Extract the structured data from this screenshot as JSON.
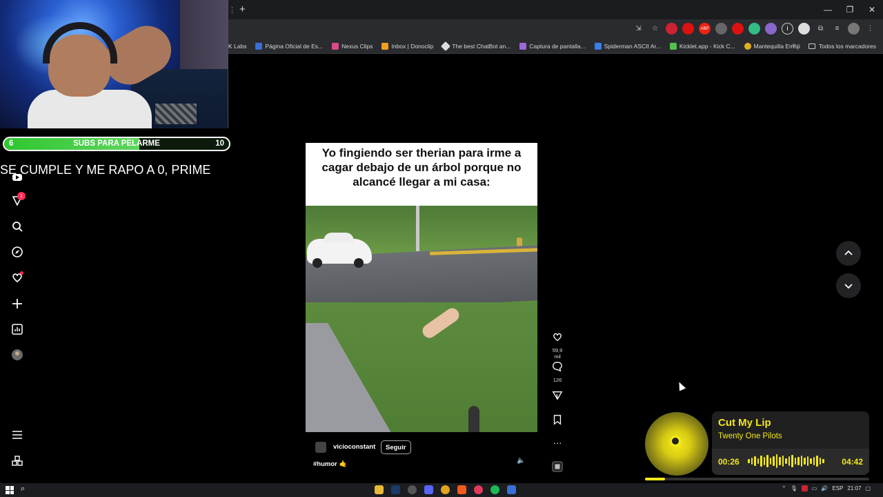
{
  "stream_overlay": {
    "subs_goal": {
      "current": "6",
      "target": "10",
      "label": "SUBS PARA PELARME",
      "progress": 0.6
    },
    "ticker_text": "SE CUMPLE Y ME RAPO A 0, PRIME"
  },
  "browser": {
    "bookmarks": [
      {
        "label": "K Labs",
        "color": "#666666"
      },
      {
        "label": "Página Oficial de Es...",
        "color": "#3a6fd8"
      },
      {
        "label": "Nexus Clips",
        "color": "#d84a8a"
      },
      {
        "label": "Inbox | Donoclip",
        "color": "#f0a020"
      },
      {
        "label": "The best ChatBot an...",
        "color": "#dddddd"
      },
      {
        "label": "Captura de pantalla...",
        "color": "#9b6ad8"
      },
      {
        "label": "Spiderman ASCII Ar...",
        "color": "#3a7ee8"
      },
      {
        "label": "Kicklet.app - Kick C...",
        "color": "#53c24a"
      },
      {
        "label": "Mantequilla Emoji",
        "color": "#e0b020"
      }
    ],
    "all_bookmarks_label": "Todos los marcadores",
    "more_label": "»"
  },
  "video": {
    "caption": "Yo fingiendo ser therian para irme a cagar debajo de un árbol porque no alcancé llegar a mi casa:",
    "username": "vicioconstant",
    "follow_label": "Seguir",
    "hashtag": "#humor 🤙"
  },
  "actions": {
    "likes": "59,9 mil",
    "comments": "126",
    "more": "···"
  },
  "sidebar": {
    "notification_count": "1"
  },
  "music": {
    "title": "Cut My Lip",
    "artist": "Twenty One Pilots",
    "elapsed": "00:26",
    "duration": "04:42",
    "progress": 0.09
  },
  "taskbar": {
    "language": "ESP",
    "time": "21:07"
  },
  "colors": {
    "accent_yellow": "#f2e81c",
    "tiktok_red": "#fe2c55",
    "subs_green": "#2fc72f"
  }
}
